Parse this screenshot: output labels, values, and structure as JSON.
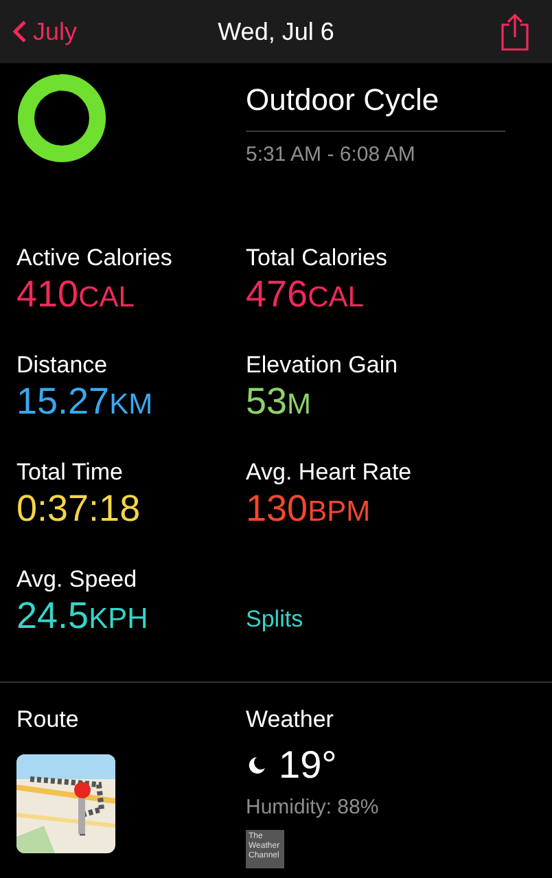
{
  "nav": {
    "back": "July",
    "title": "Wed, Jul 6"
  },
  "workout": {
    "title": "Outdoor Cycle",
    "time_range": "5:31 AM - 6:08 AM"
  },
  "stats": [
    {
      "label": "Active Calories",
      "value": "410",
      "unit": "CAL",
      "color": "#f2295a"
    },
    {
      "label": "Total Calories",
      "value": "476",
      "unit": "CAL",
      "color": "#f2295a"
    },
    {
      "label": "Distance",
      "value": "15.27",
      "unit": "KM",
      "color": "#3aa8f0"
    },
    {
      "label": "Elevation Gain",
      "value": "53",
      "unit": "M",
      "color": "#8ed16b"
    },
    {
      "label": "Total Time",
      "value": "0:37:18",
      "color": "#f5d547"
    },
    {
      "label": "Avg. Heart Rate",
      "value": "130",
      "unit": "BPM",
      "color": "#f2472e"
    },
    {
      "label": "Avg. Speed",
      "value": "24.5",
      "unit": "KPH",
      "color": "#35d6c9"
    }
  ],
  "splits_link": "Splits",
  "route": {
    "label": "Route"
  },
  "weather": {
    "label": "Weather",
    "temperature": "19°",
    "humidity": "Humidity: 88%",
    "logo": "The Weather Channel"
  }
}
